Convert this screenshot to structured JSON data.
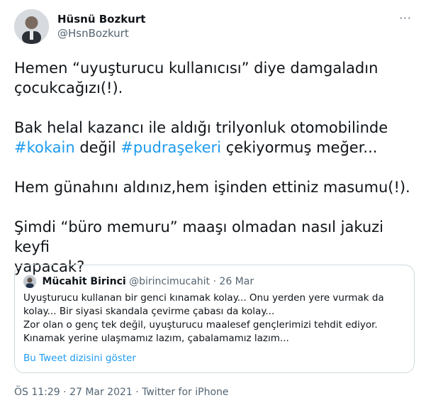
{
  "author": {
    "display_name": "Hüsnü Bozkurt",
    "username": "@HsnBozkurt"
  },
  "more_label": "···",
  "tweet": {
    "lines": {
      "p1_l1": "Hemen “uyuşturucu kullanıcısı” diye damgaladın",
      "p1_l2": "çocukcağızı(!).",
      "p2_l1": "Bak helal kazancı ile aldığı trilyonluk otomobilinde",
      "p2_l2_hashtag1": "#kokain",
      "p2_l2_mid": " değil ",
      "p2_l2_hashtag2": "#pudraşekeri",
      "p2_l2_end": " çekiyormuş meğer...",
      "p3_l1": "Hem günahını aldınız,hem işinden ettiniz masumu(!).",
      "p4_l1": "Şimdi “büro memuru” maaşı olmadan nasıl jakuzi keyfi",
      "p4_l2": "yapacak?"
    }
  },
  "quoted": {
    "display_name": "Mücahit Birinci",
    "username": "@birincimucahit",
    "separator": "·",
    "date": "26 Mar",
    "lines": [
      "Uyuşturucu kullanan bir genci kınamak kolay... Onu yerden yere vurmak da",
      "kolay... Bir siyasi skandala çevirme çabası da kolay...",
      "Zor olan o genç tek değil, uyuşturucu maalesef gençlerimizi tehdit ediyor.",
      "Kınamak yerine ulaşmamız lazım, çabalamamız lazım..."
    ],
    "show_thread": "Bu Tweet dizisini göster"
  },
  "meta": {
    "time": "ÖS 11:29",
    "separator1": " · ",
    "date": "27 Mar 2021",
    "separator2": " · ",
    "source": "Twitter for iPhone"
  },
  "colors": {
    "accent": "#1d9bf0",
    "secondary_text": "#536471",
    "border": "#cfd9de"
  }
}
